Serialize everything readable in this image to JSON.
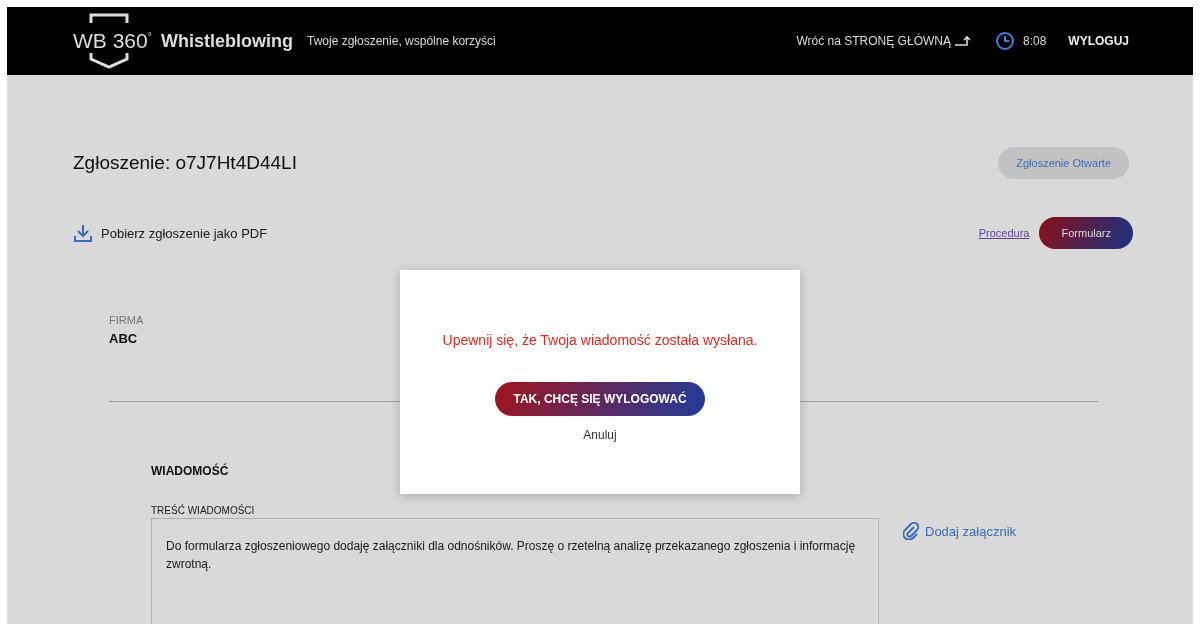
{
  "header": {
    "logo_text": "WB 360",
    "logo_degree": "°",
    "brand": "Whistleblowing",
    "tagline": "Twoje zgłoszenie, wspólne korzyści",
    "home_link": "Wróć na STRONĘ GŁÓWNĄ",
    "time": "8:08",
    "logout": "WYLOGUJ"
  },
  "report": {
    "title": "Zgłoszenie: o7J7Ht4D44LI",
    "status": "Zgłoszenie Otwarte",
    "download": "Pobierz zgłoszenie jako PDF",
    "procedure_link": "Procedura",
    "form_button": "Formularz"
  },
  "company": {
    "label": "FIRMA",
    "value": "ABC"
  },
  "message": {
    "section_title": "WIADOMOŚĆ",
    "field_label": "TREŚĆ WIADOMOŚCI",
    "value": "Do formularza zgłoszeniowego dodaję załączniki dla odnośników. Proszę o rzetelną analizę przekazanego zgłoszenia i informację zwrotną.",
    "attach": "Dodaj załącznik"
  },
  "dialog": {
    "message": "Upewnij się, że Twoja wiadomość została wysłana.",
    "confirm": "TAK, CHCĘ SIĘ WYLOGOWAĆ",
    "cancel": "Anuluj"
  }
}
